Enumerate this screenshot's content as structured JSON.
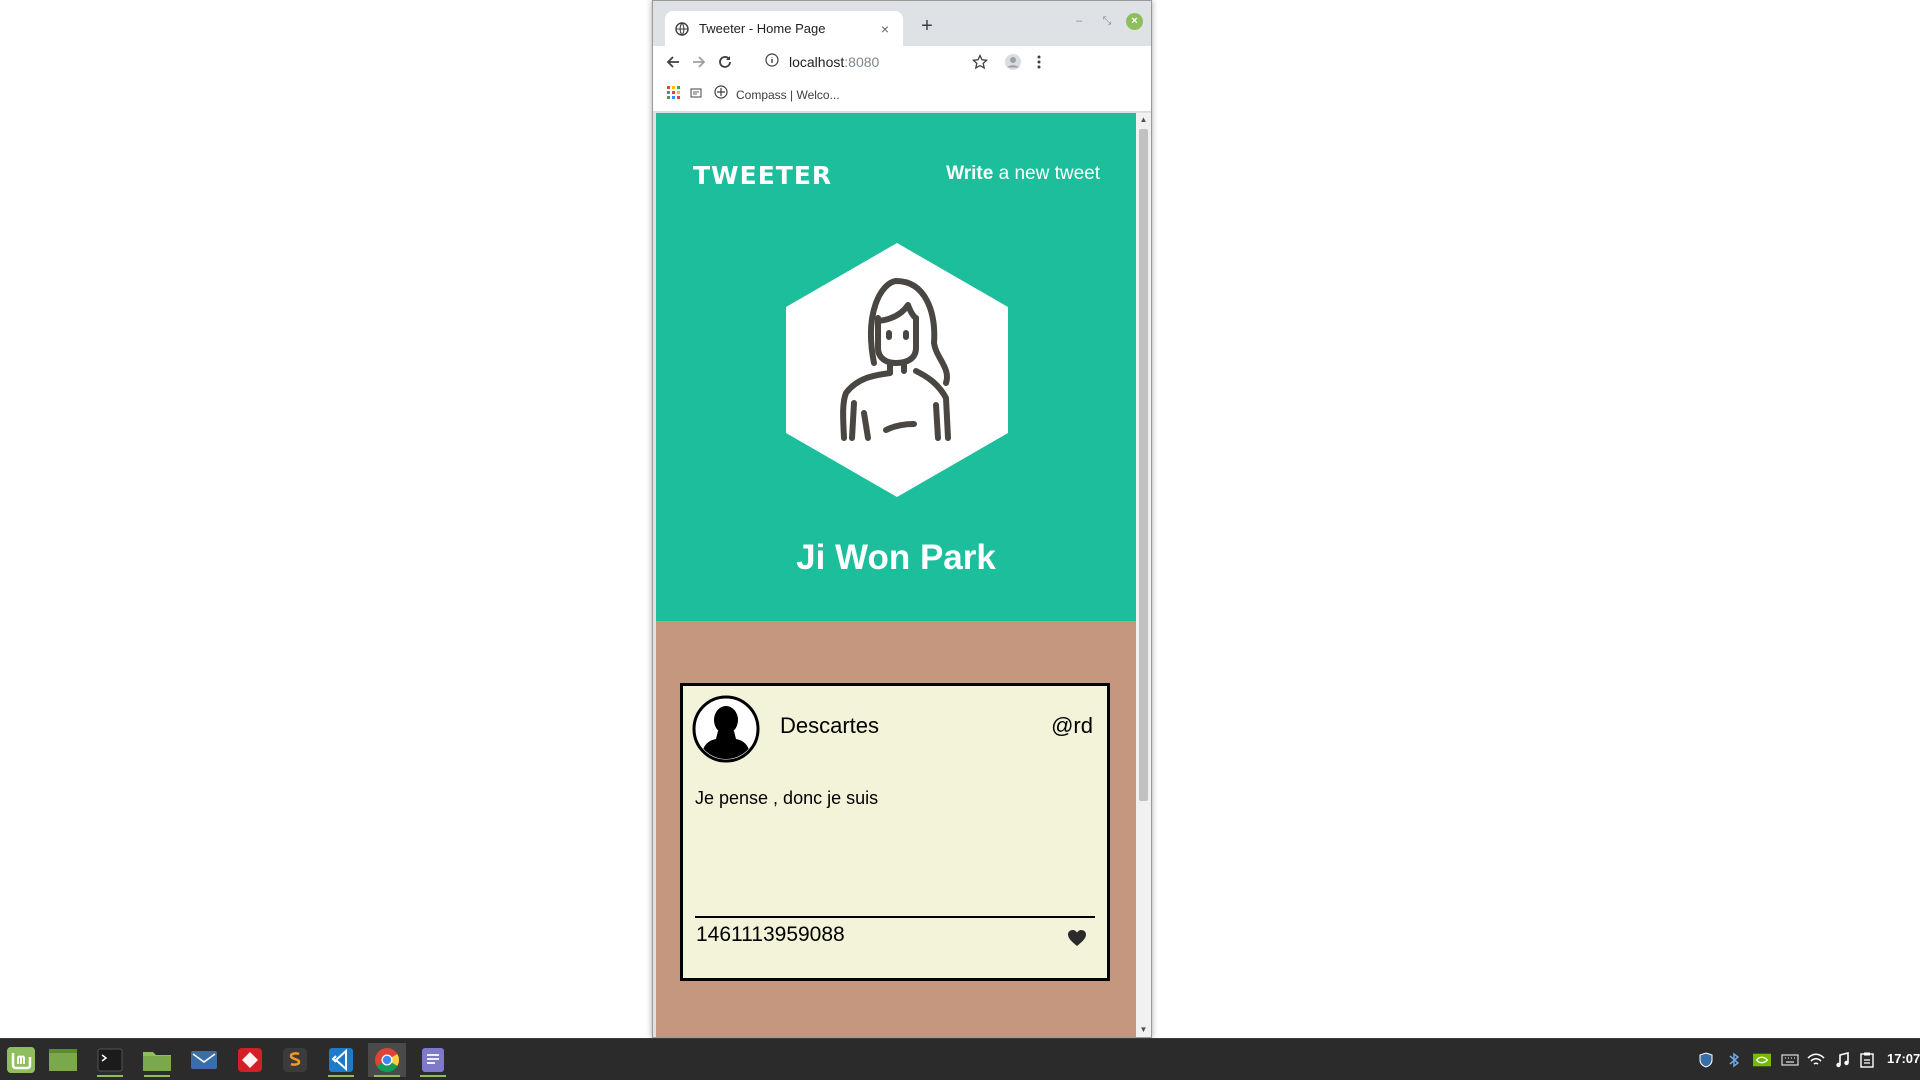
{
  "browser": {
    "tab_title": "Tweeter - Home Page",
    "tab_close": "×",
    "new_tab": "+",
    "url_host": "localhost",
    "url_port": ":8080",
    "bookmark_label": "Compass | Welco..."
  },
  "app": {
    "logo": "TWEETER",
    "write_bold": "Write",
    "write_rest": " a new tweet",
    "user_name": "Ji Won Park"
  },
  "tweets": [
    {
      "author": "Descartes",
      "handle": "@rd",
      "text": "Je pense , donc je suis",
      "timestamp": "1461113959088"
    }
  ],
  "colors": {
    "hero_bg": "#1dbe9b",
    "feed_bg": "#c4977e",
    "tweet_bg": "#f3f3d9",
    "avatar_stroke": "#4a4742"
  },
  "taskbar": {
    "apps": [
      "mint-menu",
      "desktop",
      "terminal",
      "files",
      "mail",
      "anydesk",
      "sublime-text",
      "vscode",
      "chrome",
      "text-editor"
    ],
    "tray": [
      "shield",
      "bluetooth",
      "nvidia",
      "keyboard",
      "wifi",
      "music",
      "clipboard"
    ],
    "clock": "17:07"
  }
}
